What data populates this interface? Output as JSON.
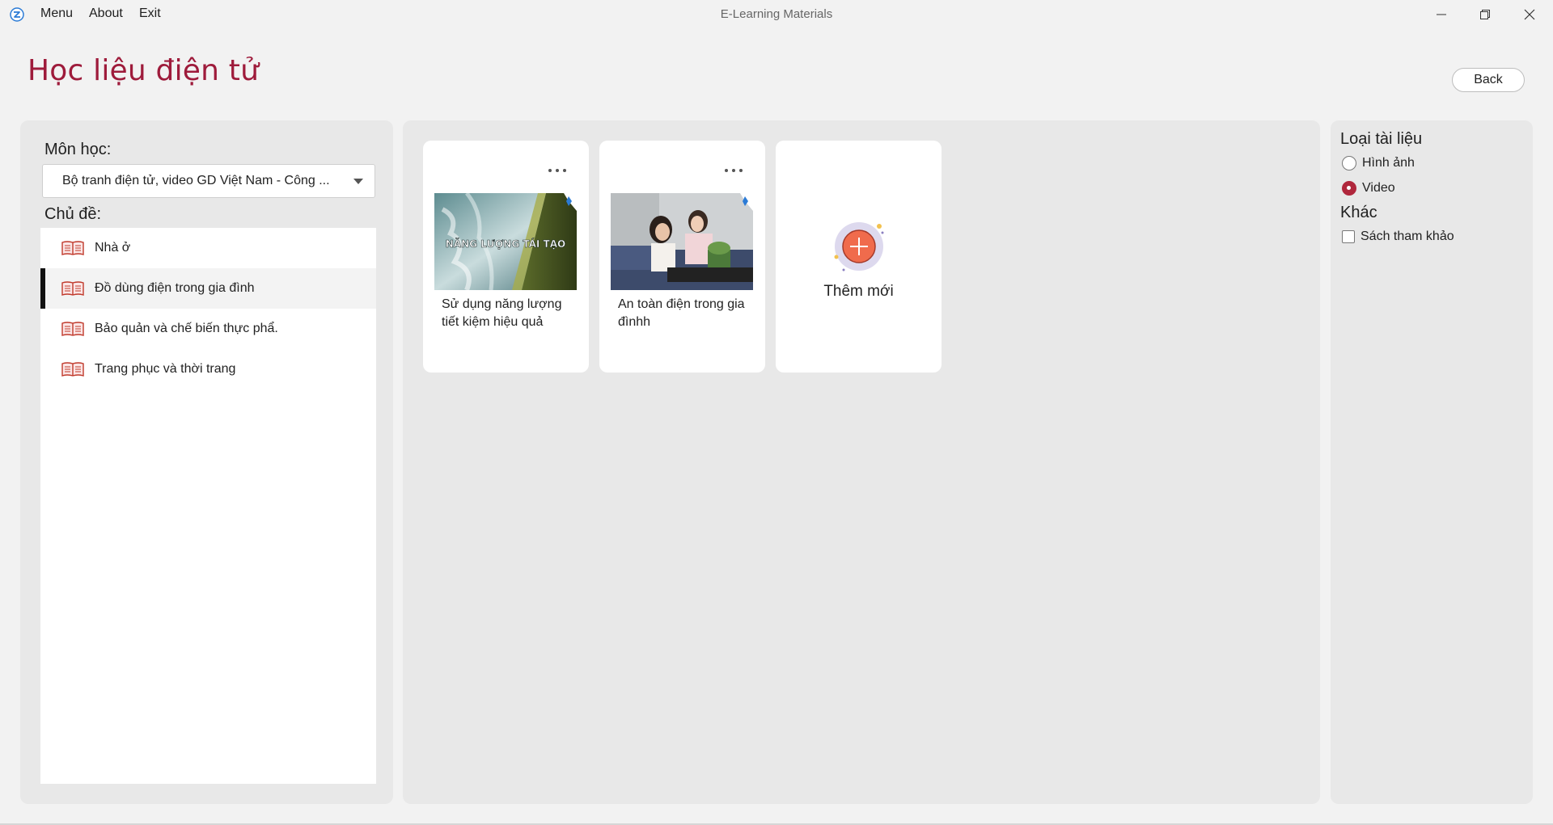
{
  "window": {
    "title": "E-Learning Materials",
    "menu": [
      "Menu",
      "About",
      "Exit"
    ]
  },
  "header": {
    "page_title": "Học liệu điện tử",
    "back_label": "Back"
  },
  "left_panel": {
    "subject_label": "Môn học:",
    "subject_value": "Bộ tranh điện tử, video GD Việt Nam - Công ...",
    "topic_label": "Chủ đề:",
    "topics": [
      {
        "label": "Nhà ở",
        "selected": false
      },
      {
        "label": "Đồ dùng điện trong gia đình",
        "selected": true
      },
      {
        "label": "Bảo quản và chế biến thực phẩ.",
        "selected": false
      },
      {
        "label": "Trang phục và thời trang",
        "selected": false
      }
    ]
  },
  "materials": [
    {
      "caption": "Sử dụng năng lượng tiết kiệm hiệu quả",
      "thumb_text": "NĂNG LƯỢNG TÁI TẠO"
    },
    {
      "caption": "An toàn điện trong gia đìnhh"
    }
  ],
  "add_new_label": "Thêm mới",
  "right_panel": {
    "type_label": "Loại tài liệu",
    "type_options": [
      {
        "label": "Hình ảnh",
        "checked": false
      },
      {
        "label": "Video",
        "checked": true
      }
    ],
    "other_label": "Khác",
    "other_options": [
      {
        "label": "Sách tham khảo",
        "checked": false
      }
    ]
  },
  "colors": {
    "accent": "#9e1b3b",
    "radio_active": "#b0273c",
    "panel_bg": "#e8e8e8",
    "page_bg": "#f2f2f2"
  }
}
